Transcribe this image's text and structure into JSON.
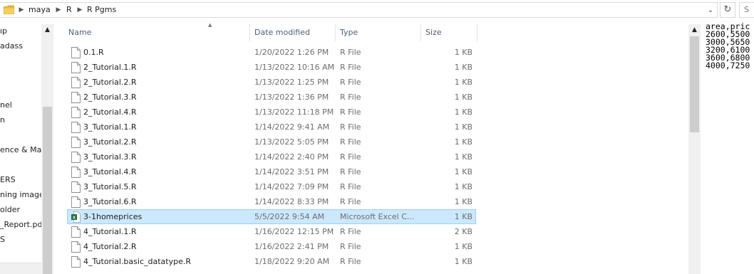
{
  "address_bar": {
    "breadcrumbs": [
      "maya",
      "R",
      "R Pgms"
    ],
    "search_placeholder": "S"
  },
  "nav_pane": {
    "items": [
      {
        "label": "ıp"
      },
      {
        "label": "adass"
      },
      {
        "label": "nel"
      },
      {
        "label": "n"
      },
      {
        "label": "ence & Mac"
      },
      {
        "label": "ERS"
      },
      {
        "label": "ning images"
      },
      {
        "label": "older"
      },
      {
        "label": "_Report.pdf"
      },
      {
        "label": "S"
      }
    ]
  },
  "file_list": {
    "columns": {
      "name": "Name",
      "date_modified": "Date modified",
      "type": "Type",
      "size": "Size"
    },
    "rows": [
      {
        "name": "0.1.R",
        "date": "1/20/2022 1:26 PM",
        "type": "R File",
        "size": "1 KB",
        "icon": "file-icon",
        "selected": false
      },
      {
        "name": "2_Tutorial.1.R",
        "date": "1/13/2022 10:16 AM",
        "type": "R File",
        "size": "1 KB",
        "icon": "file-icon",
        "selected": false
      },
      {
        "name": "2_Tutorial.2.R",
        "date": "1/13/2022 1:25 PM",
        "type": "R File",
        "size": "1 KB",
        "icon": "file-icon",
        "selected": false
      },
      {
        "name": "2_Tutorial.3.R",
        "date": "1/13/2022 1:36 PM",
        "type": "R File",
        "size": "1 KB",
        "icon": "file-icon",
        "selected": false
      },
      {
        "name": "2_Tutorial.4.R",
        "date": "1/13/2022 11:18 PM",
        "type": "R File",
        "size": "1 KB",
        "icon": "file-icon",
        "selected": false
      },
      {
        "name": "3_Tutorial.1.R",
        "date": "1/14/2022 9:41 AM",
        "type": "R File",
        "size": "1 KB",
        "icon": "file-icon",
        "selected": false
      },
      {
        "name": "3_Tutorial.2.R",
        "date": "1/13/2022 5:05 PM",
        "type": "R File",
        "size": "1 KB",
        "icon": "file-icon",
        "selected": false
      },
      {
        "name": "3_Tutorial.3.R",
        "date": "1/14/2022 2:40 PM",
        "type": "R File",
        "size": "1 KB",
        "icon": "file-icon",
        "selected": false
      },
      {
        "name": "3_Tutorial.4.R",
        "date": "1/14/2022 3:51 PM",
        "type": "R File",
        "size": "1 KB",
        "icon": "file-icon",
        "selected": false
      },
      {
        "name": "3_Tutorial.5.R",
        "date": "1/14/2022 7:09 PM",
        "type": "R File",
        "size": "1 KB",
        "icon": "file-icon",
        "selected": false
      },
      {
        "name": "3_Tutorial.6.R",
        "date": "1/14/2022 8:33 PM",
        "type": "R File",
        "size": "1 KB",
        "icon": "file-icon",
        "selected": false
      },
      {
        "name": "3-1homeprices",
        "date": "5/5/2022 9:54 AM",
        "type": "Microsoft Excel C...",
        "size": "1 KB",
        "icon": "excel-csv-icon",
        "selected": true
      },
      {
        "name": "4_Tutorial.1.R",
        "date": "1/16/2022 12:15 PM",
        "type": "R File",
        "size": "2 KB",
        "icon": "file-icon",
        "selected": false
      },
      {
        "name": "4_Tutorial.2.R",
        "date": "1/16/2022 2:41 PM",
        "type": "R File",
        "size": "1 KB",
        "icon": "file-icon",
        "selected": false
      },
      {
        "name": "4_Tutorial.basic_datatype.R",
        "date": "1/18/2022 9:20 AM",
        "type": "R File",
        "size": "1 KB",
        "icon": "file-icon",
        "selected": false
      }
    ]
  },
  "preview_pane": {
    "lines": [
      "area,pric",
      "2600,5500",
      "3000,5650",
      "3200,6100",
      "3600,6800",
      "4000,7250"
    ]
  },
  "colors": {
    "selection_bg": "#cce8ff",
    "selection_border": "#99d1ff",
    "header_text": "#4c607a",
    "meta_text": "#6d6d6d",
    "folder_yellow": "#e8b83c",
    "excel_green": "#1e7145"
  }
}
